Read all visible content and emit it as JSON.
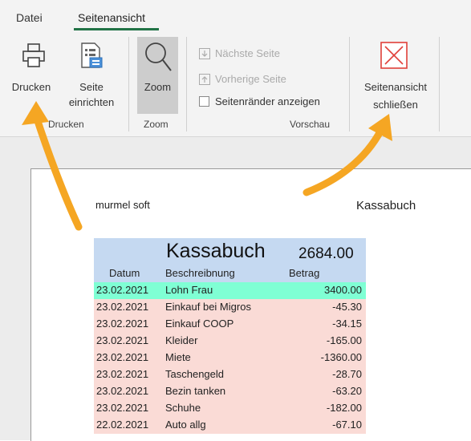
{
  "tabs": [
    {
      "label": "Datei"
    },
    {
      "label": "Seitenansicht"
    }
  ],
  "ribbon": {
    "print_label": "Drucken",
    "page_setup_label_1": "Seite",
    "page_setup_label_2": "einrichten",
    "zoom_label": "Zoom",
    "next_page_label": "Nächste Seite",
    "prev_page_label": "Vorherige Seite",
    "show_margins_label": "Seitenränder anzeigen",
    "show_margins_checked": false,
    "close_label_1": "Seitenansicht",
    "close_label_2": "schließen",
    "groups": [
      "Drucken",
      "Zoom",
      "Vorschau"
    ]
  },
  "colors": {
    "accent": "#217346",
    "header_fill": "#c5d9f1",
    "income_fill": "#7fffd4",
    "expense_fill": "#fadbd6",
    "close_icon": "#e0403a",
    "arrow": "#f5a623"
  },
  "page": {
    "header_left": "murmel soft",
    "header_right": "Kassabuch",
    "sheet_title": "Kassabuch",
    "sheet_total": "2684.00",
    "columns": [
      "Datum",
      "Beschreibnung",
      "Betrag"
    ],
    "rows": [
      {
        "date": "23.02.2021",
        "desc": "Lohn Frau",
        "amount": "3400.00",
        "type": "income"
      },
      {
        "date": "23.02.2021",
        "desc": "Einkauf bei Migros",
        "amount": "-45.30",
        "type": "expense"
      },
      {
        "date": "23.02.2021",
        "desc": "Einkauf COOP",
        "amount": "-34.15",
        "type": "expense"
      },
      {
        "date": "23.02.2021",
        "desc": "Kleider",
        "amount": "-165.00",
        "type": "expense"
      },
      {
        "date": "23.02.2021",
        "desc": "Miete",
        "amount": "-1360.00",
        "type": "expense"
      },
      {
        "date": "23.02.2021",
        "desc": "Taschengeld",
        "amount": "-28.70",
        "type": "expense"
      },
      {
        "date": "23.02.2021",
        "desc": "Bezin tanken",
        "amount": "-63.20",
        "type": "expense"
      },
      {
        "date": "23.02.2021",
        "desc": "Schuhe",
        "amount": "-182.00",
        "type": "expense"
      },
      {
        "date": "22.02.2021",
        "desc": "Auto allg",
        "amount": "-67.10",
        "type": "expense"
      }
    ]
  }
}
